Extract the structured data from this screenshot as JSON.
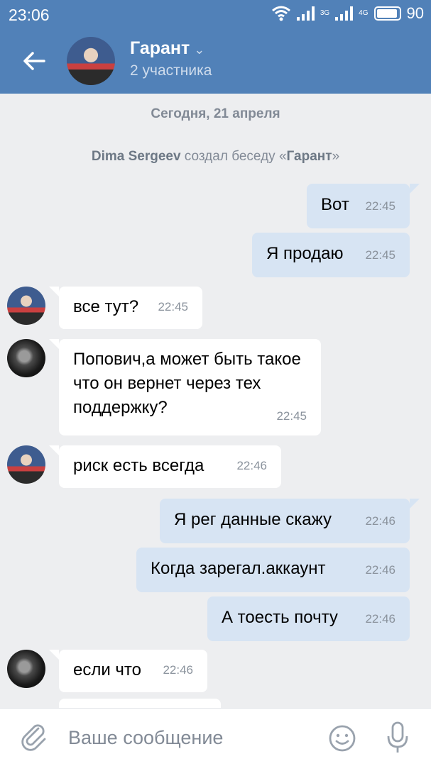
{
  "status_bar": {
    "time": "23:06",
    "net1": "3G",
    "net2": "4G",
    "battery": "90"
  },
  "header": {
    "title": "Гарант",
    "subtitle": "2 участника",
    "icons": [
      "back-arrow-icon",
      "chevron-down-icon"
    ]
  },
  "chat": {
    "date": "Сегодня, 21 апреля",
    "service": {
      "author": "Dima Sergeev",
      "action": " создал беседу «",
      "chat_name": "Гарант",
      "close": "»"
    },
    "messages": [
      {
        "dir": "out",
        "text": "Вот",
        "time": "22:45"
      },
      {
        "dir": "out",
        "text": "Я продаю",
        "time": "22:45"
      },
      {
        "dir": "in",
        "avatar": "group",
        "text": "все тут?",
        "time": "22:45"
      },
      {
        "dir": "in",
        "avatar": "dark",
        "text": "Попович,а может быть такое что он вернет через тех поддержку?",
        "time": "22:45"
      },
      {
        "dir": "in",
        "avatar": "group",
        "text": "риск есть всегда",
        "time": "22:46"
      },
      {
        "dir": "out",
        "text": "Я рег данные скажу",
        "time": "22:46"
      },
      {
        "dir": "out",
        "text": "Когда зарегал.аккаунт",
        "time": "22:46"
      },
      {
        "dir": "out",
        "text": "А тоесть почту",
        "time": "22:46"
      },
      {
        "dir": "in",
        "avatar": "dark",
        "text": "если что",
        "time": "22:46"
      }
    ]
  },
  "composer": {
    "placeholder": "Ваше сообщение",
    "icons": [
      "attach-icon",
      "emoji-icon",
      "microphone-icon"
    ]
  },
  "colors": {
    "header_bg": "#5181b8",
    "chat_bg": "#edeef0",
    "out_bubble": "#d7e4f3",
    "in_bubble": "#ffffff"
  }
}
